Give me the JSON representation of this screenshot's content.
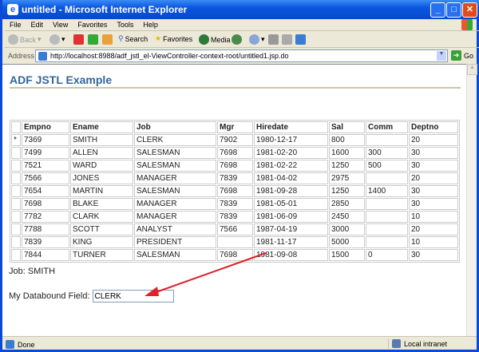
{
  "window": {
    "title": "untitled - Microsoft Internet Explorer"
  },
  "menu": [
    "File",
    "Edit",
    "View",
    "Favorites",
    "Tools",
    "Help"
  ],
  "toolbar": {
    "back": "Back",
    "search": "Search",
    "favorites": "Favorites",
    "media": "Media"
  },
  "address": {
    "label": "Address",
    "url": "http://localhost:8988/adf_jstl_el-ViewController-context-root/untitled1.jsp.do",
    "go": "Go"
  },
  "page": {
    "heading": "ADF JSTL Example",
    "table": {
      "columns": [
        "Empno",
        "Ename",
        "Job",
        "Mgr",
        "Hiredate",
        "Sal",
        "Comm",
        "Deptno"
      ],
      "current_row_marker": "*",
      "rows": [
        [
          "7369",
          "SMITH",
          "CLERK",
          "7902",
          "1980-12-17",
          "800",
          "",
          "20"
        ],
        [
          "7499",
          "ALLEN",
          "SALESMAN",
          "7698",
          "1981-02-20",
          "1600",
          "300",
          "30"
        ],
        [
          "7521",
          "WARD",
          "SALESMAN",
          "7698",
          "1981-02-22",
          "1250",
          "500",
          "30"
        ],
        [
          "7566",
          "JONES",
          "MANAGER",
          "7839",
          "1981-04-02",
          "2975",
          "",
          "20"
        ],
        [
          "7654",
          "MARTIN",
          "SALESMAN",
          "7698",
          "1981-09-28",
          "1250",
          "1400",
          "30"
        ],
        [
          "7698",
          "BLAKE",
          "MANAGER",
          "7839",
          "1981-05-01",
          "2850",
          "",
          "30"
        ],
        [
          "7782",
          "CLARK",
          "MANAGER",
          "7839",
          "1981-06-09",
          "2450",
          "",
          "10"
        ],
        [
          "7788",
          "SCOTT",
          "ANALYST",
          "7566",
          "1987-04-19",
          "3000",
          "",
          "20"
        ],
        [
          "7839",
          "KING",
          "PRESIDENT",
          "",
          "1981-11-17",
          "5000",
          "",
          "10"
        ],
        [
          "7844",
          "TURNER",
          "SALESMAN",
          "7698",
          "1981-09-08",
          "1500",
          "0",
          "30"
        ]
      ]
    },
    "job_line": "Job: SMITH",
    "field_label": "My Databound Field:",
    "field_value": "CLERK",
    "annotation_color": "#e0202a"
  },
  "status": {
    "left": "Done",
    "zone": "Local intranet"
  }
}
